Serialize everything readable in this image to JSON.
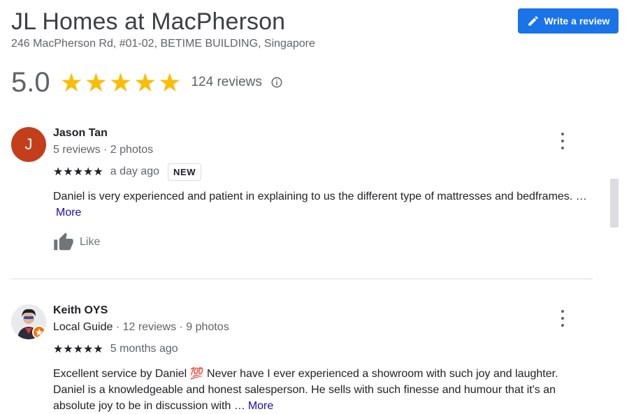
{
  "place": {
    "name": "JL Homes at MacPherson",
    "address": "246 MacPherson Rd, #01-02, BETIME BUILDING, Singapore"
  },
  "write_review_label": "Write a review",
  "summary": {
    "score": "5.0",
    "star_rating": 5,
    "stars_text": "★★★★★",
    "reviews_label": "124 reviews"
  },
  "reviews": [
    {
      "avatar_letter": "J",
      "name": "Jason Tan",
      "meta": "5 reviews · 2 photos",
      "stars_text": "★★★★★",
      "rating": 5,
      "time": "a day ago",
      "badge": "NEW",
      "text": "Daniel is very experienced and patient in explaining to us the different type of mattresses and bedframes. …",
      "more_label": "More",
      "like_label": "Like"
    },
    {
      "name": "Keith OYS",
      "guide_label": "Local Guide",
      "meta": " · 12 reviews · 9 photos",
      "stars_text": "★★★★★",
      "rating": 5,
      "time": "5 months ago",
      "text": "Excellent service by Daniel 💯 Never have I ever experienced a showroom with such joy and laughter. Daniel is a knowledgeable and honest salesperson. He sells with such finesse and humour that it's an absolute joy to be in discussion with …",
      "more_label": "More"
    }
  ],
  "colors": {
    "accent": "#1a73e8",
    "star": "#fbbc04",
    "avatar_j": "#c43e1c",
    "link": "#1a0dab"
  },
  "icons": {
    "write": "pencil-icon",
    "info": "info-icon",
    "menu": "more-vert-icon",
    "like": "thumb-up-icon",
    "guide": "local-guide-badge-icon"
  }
}
